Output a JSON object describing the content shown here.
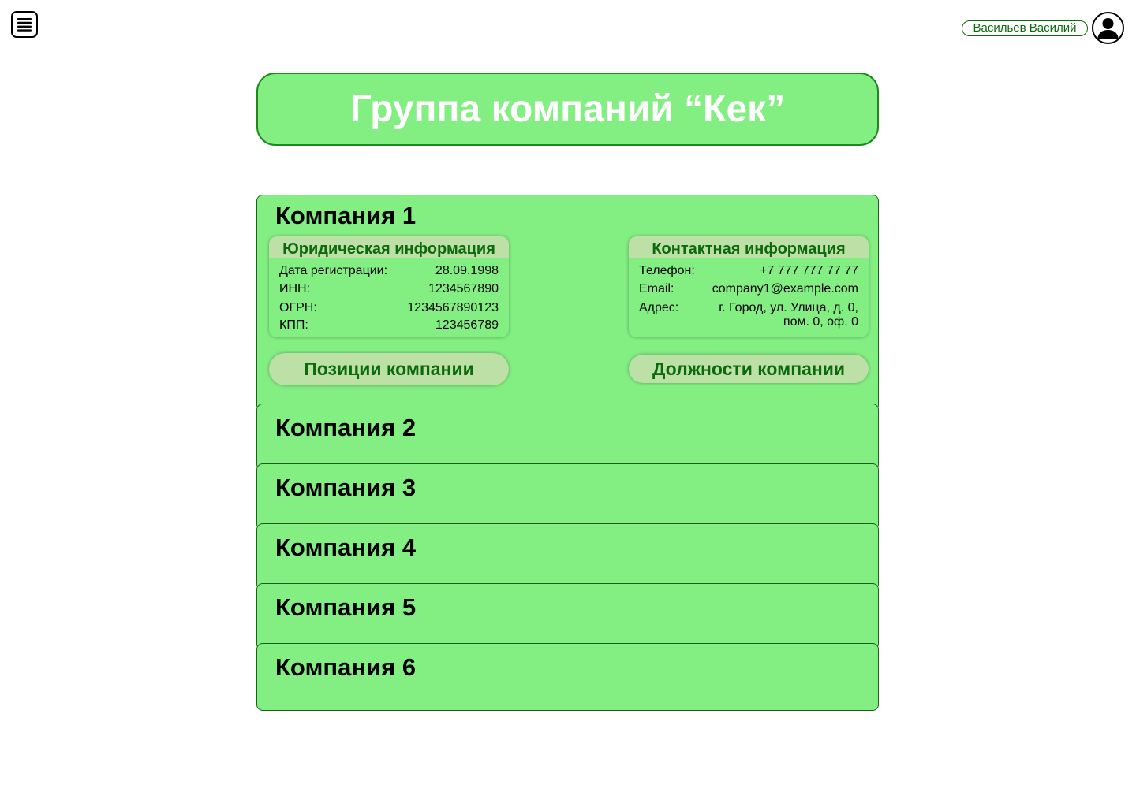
{
  "header": {
    "menu_icon": "hamburger-menu-icon",
    "user_name": "Васильев Василий",
    "avatar_icon": "user-avatar-icon"
  },
  "group": {
    "title": "Группа компаний “Кек”"
  },
  "colors": {
    "panel": "#83ef83",
    "card_header": "#bde0a6",
    "accent_text": "#0b6a0b",
    "title_text": "#ffffff"
  },
  "companies": [
    {
      "name": "Компания 1",
      "expanded": true,
      "legal": {
        "title": "Юридическая информация",
        "rows": [
          {
            "label": "Дата регистрации:",
            "value": "28.09.1998"
          },
          {
            "label": "ИНН:",
            "value": "1234567890"
          },
          {
            "label": "ОГРН:",
            "value": "1234567890123"
          },
          {
            "label": "КПП:",
            "value": "123456789"
          }
        ]
      },
      "contact": {
        "title": "Контактная информация",
        "rows": [
          {
            "label": "Телефон:",
            "value": "+7 777 777 77 77"
          },
          {
            "label": "Email:",
            "value": "company1@example.com"
          },
          {
            "label": "Адрес:",
            "value": "г. Город, ул. Улица, д. 0,",
            "value2": "пом. 0, оф. 0"
          }
        ]
      },
      "positions_button": "Позиции компании",
      "jobs_button": "Должности компании"
    },
    {
      "name": "Компания 2",
      "expanded": false
    },
    {
      "name": "Компания 3",
      "expanded": false
    },
    {
      "name": "Компания 4",
      "expanded": false
    },
    {
      "name": "Компания 5",
      "expanded": false
    },
    {
      "name": "Компания 6",
      "expanded": false
    }
  ]
}
